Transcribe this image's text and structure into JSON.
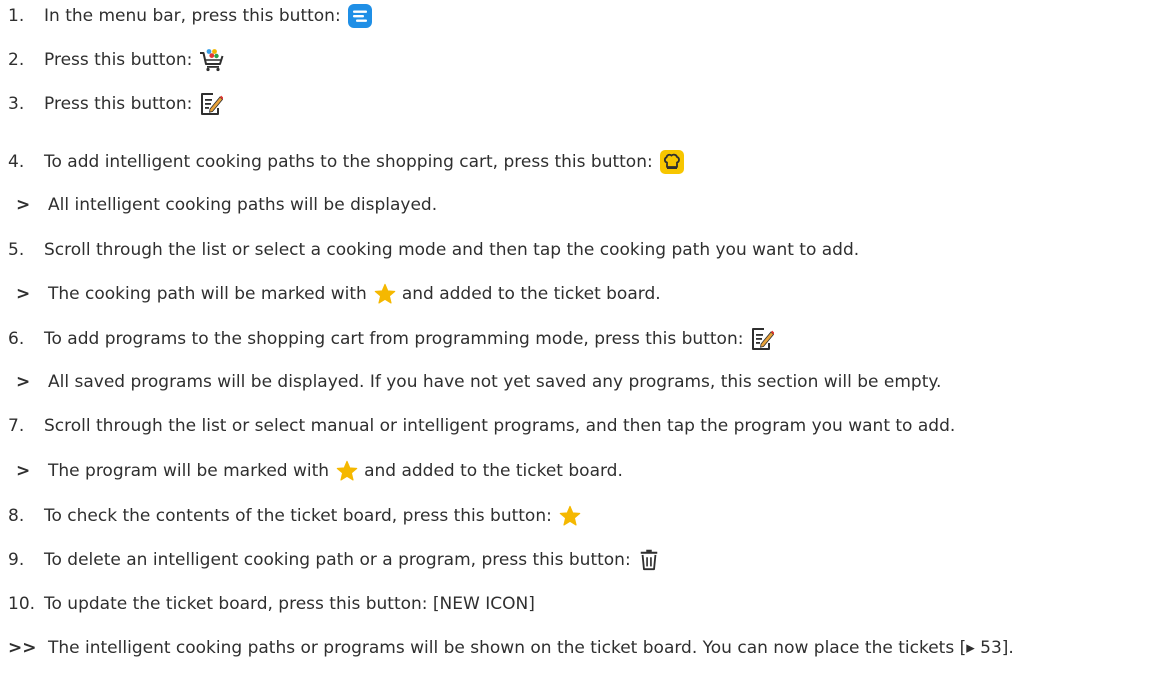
{
  "steps": [
    {
      "num": "1.",
      "text": "In the menu bar, press this button:",
      "icon": "menu-bar-icon"
    },
    {
      "num": "2.",
      "text": "Press this button:",
      "icon": "shopping-cart-icon"
    },
    {
      "num": "3.",
      "text": "Press this button:",
      "icon": "edit-program-icon"
    },
    {
      "num": "4.",
      "text": "To add intelligent cooking paths to the shopping cart, press this button:",
      "icon": "chef-hat-icon"
    },
    {
      "result": ">",
      "text": "All intelligent cooking paths will be displayed."
    },
    {
      "num": "5.",
      "text": "Scroll through the list or select a cooking mode and then tap the cooking path you want to add."
    },
    {
      "result": ">",
      "text_before": "The cooking path will be marked with",
      "icon": "star-icon",
      "text_after": "and added to the ticket board."
    },
    {
      "num": "6.",
      "text": "To add programs to the shopping cart from programming mode, press this button:",
      "icon": "edit-program-icon"
    },
    {
      "result": ">",
      "text": "All saved programs will be displayed. If you have not yet saved any programs, this section will be empty."
    },
    {
      "num": "7.",
      "text": "Scroll through the list or select manual or intelligent programs, and then tap the program you want to add."
    },
    {
      "result": ">",
      "text_before": "The program will be marked with",
      "icon": "star-icon",
      "text_after": "and added to the ticket board."
    },
    {
      "num": "8.",
      "text": "To check the contents of the ticket board, press this button:",
      "icon": "star-icon"
    },
    {
      "num": "9.",
      "text": "To delete an intelligent cooking path or a program, press this button:",
      "icon": "trash-icon"
    },
    {
      "num": "10.",
      "text": "To update the ticket board, press this button: [NEW ICON]"
    },
    {
      "result": ">>",
      "text": "The intelligent cooking paths or programs will be shown on the ticket board. You can now place the tickets [▸ 53]."
    }
  ],
  "colors": {
    "text": "#2f2f2f",
    "menu_icon_bg": "#1f8fe6",
    "chef_icon_bg": "#f7c600",
    "star": "#f5b800",
    "pencil": "#e0342f"
  }
}
